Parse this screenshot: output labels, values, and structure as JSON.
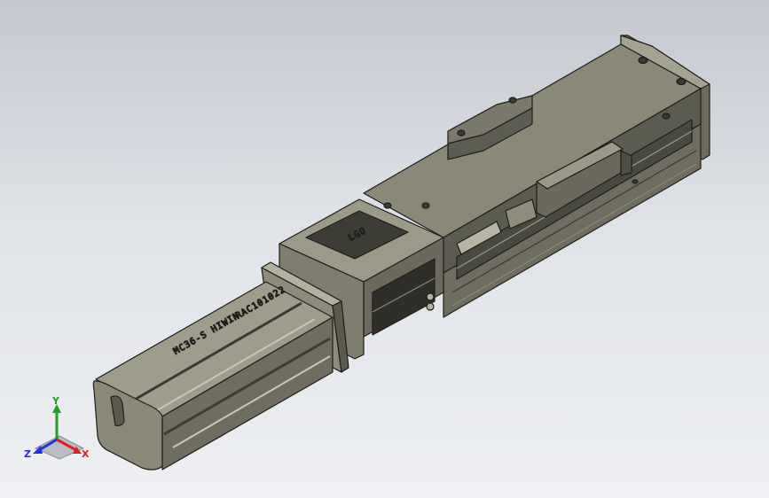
{
  "viewport": {
    "engraving_model": "RAC101022",
    "engraving_motor": "MC36-S HIWIN",
    "plate_logo": "LGO"
  },
  "triad": {
    "x_label": "X",
    "y_label": "Y",
    "z_label": "Z",
    "x_color": "#e02020",
    "y_color": "#20a020",
    "z_color": "#2030e0"
  },
  "colors": {
    "body": "#807f70",
    "body_dark": "#4f4e44",
    "body_light": "#a9a897",
    "edge": "#1e1e1a"
  }
}
